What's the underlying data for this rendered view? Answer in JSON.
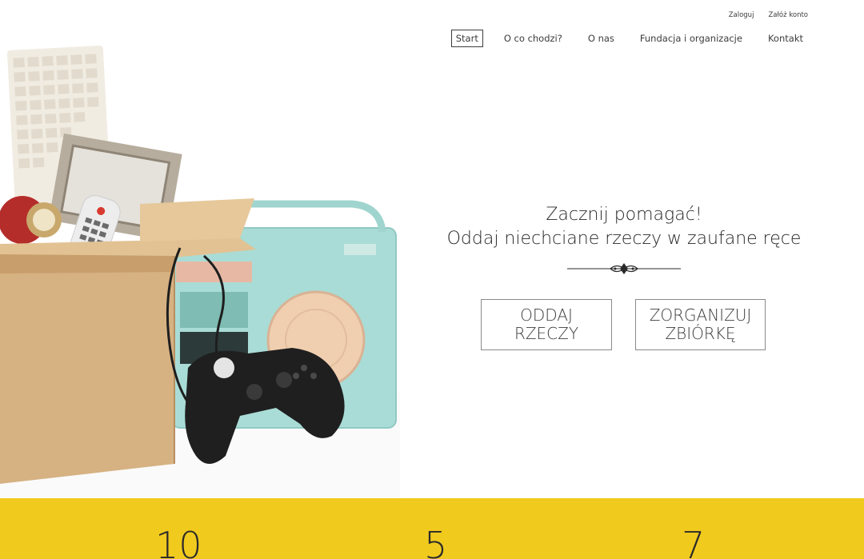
{
  "auth": {
    "login": "Zaloguj",
    "register": "Załóż konto"
  },
  "nav": {
    "items": [
      {
        "label": "Start",
        "active": true
      },
      {
        "label": "O co chodzi?",
        "active": false
      },
      {
        "label": "O nas",
        "active": false
      },
      {
        "label": "Fundacja i organizacje",
        "active": false
      },
      {
        "label": "Kontakt",
        "active": false
      }
    ]
  },
  "hero": {
    "line1": "Zacznij pomagać!",
    "line2": "Oddaj niechciane rzeczy w zaufane ręce",
    "btn_give": "ODDAJ\nRZECZY",
    "btn_organize": "ZORGANIZUJ\nZBIÓRKĘ"
  },
  "stats": {
    "values": [
      "10",
      "5",
      "7"
    ]
  },
  "colors": {
    "accent_yellow": "#f1ca1e",
    "text": "#3c3c3c"
  }
}
